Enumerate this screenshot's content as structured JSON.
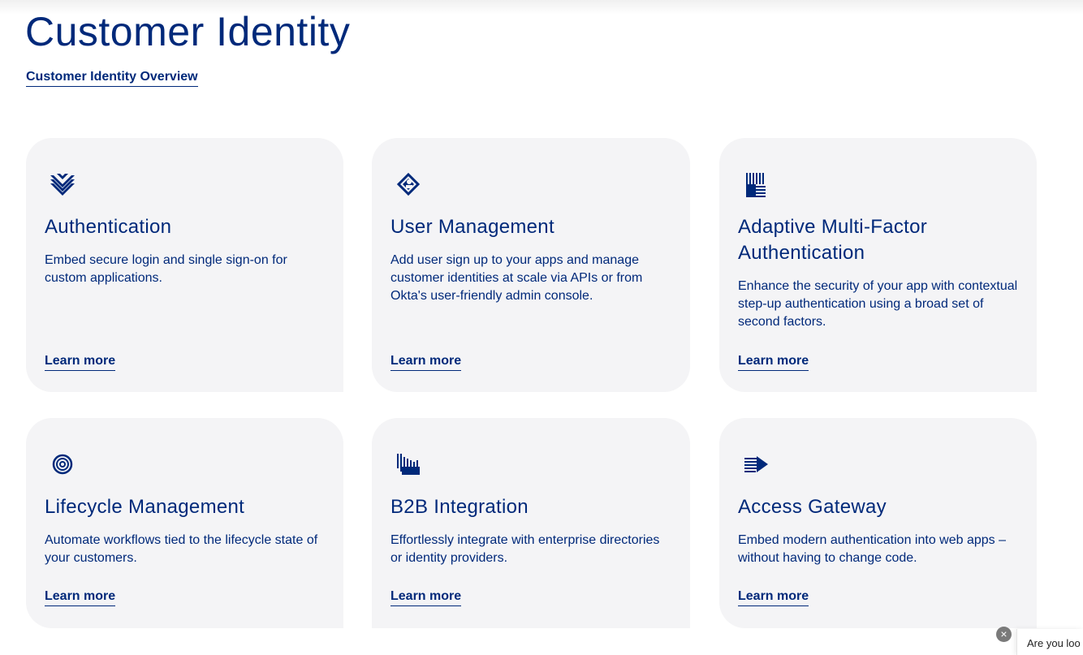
{
  "page": {
    "title": "Customer Identity",
    "overview_link": "Customer Identity Overview"
  },
  "cards": [
    {
      "icon": "layered-chevrons-icon",
      "title": "Authentication",
      "description": "Embed secure login and single sign-on for custom applications.",
      "link": "Learn more"
    },
    {
      "icon": "diamond-user-icon",
      "title": "User Management",
      "description": "Add user sign up to your apps and manage customer identities at scale via APIs or from Okta's user-friendly admin console.",
      "link": "Learn more"
    },
    {
      "icon": "striped-blocks-icon",
      "title": "Adaptive Multi-Factor Authentication",
      "description": "Enhance the security of your app with contextual step-up authentication using a broad set of second factors.",
      "link": "Learn more"
    },
    {
      "icon": "concentric-circles-icon",
      "title": "Lifecycle Management",
      "description": "Automate workflows tied to the lifecycle state of your customers.",
      "link": "Learn more"
    },
    {
      "icon": "barcode-columns-icon",
      "title": "B2B Integration",
      "description": "Effortlessly integrate with enterprise directories or identity providers.",
      "link": "Learn more"
    },
    {
      "icon": "striped-arrow-icon",
      "title": "Access Gateway",
      "description": "Embed modern authentication into web apps – without having to change code.",
      "link": "Learn more"
    }
  ],
  "chat": {
    "close_glyph": "×",
    "teaser_text": "Are you loo"
  },
  "colors": {
    "brand_navy": "#00297a",
    "card_background": "#f4f4f6"
  }
}
